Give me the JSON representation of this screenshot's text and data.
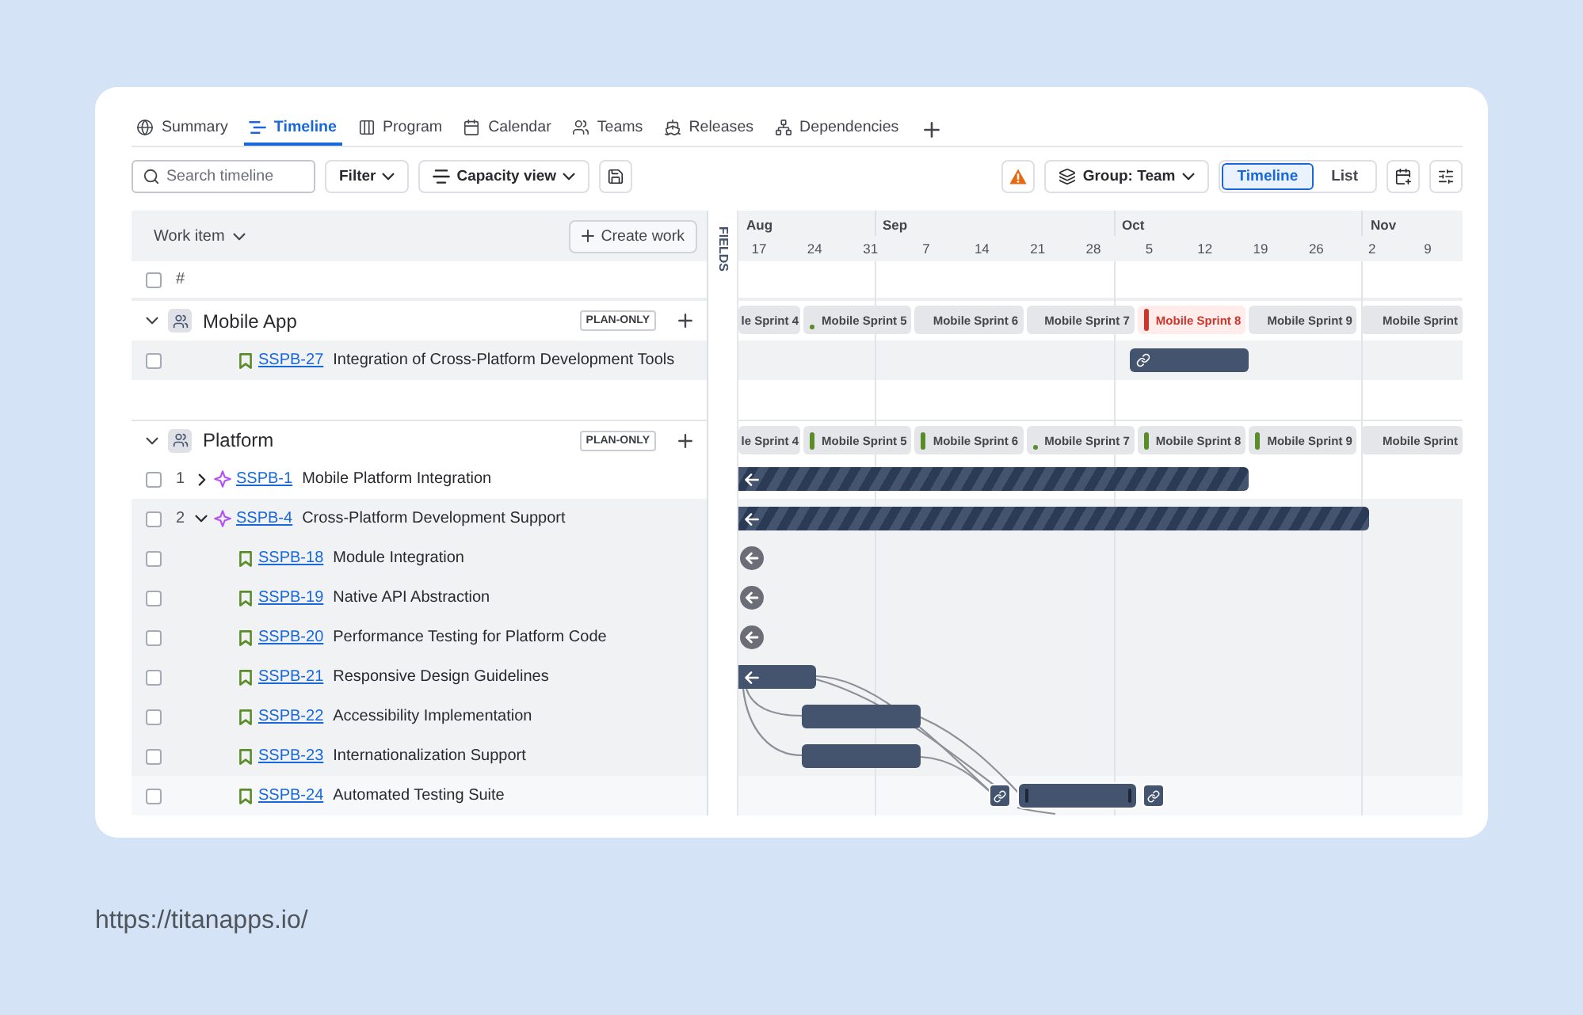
{
  "tabs": [
    {
      "label": "Summary",
      "selected": false
    },
    {
      "label": "Timeline",
      "selected": true
    },
    {
      "label": "Program",
      "selected": false
    },
    {
      "label": "Calendar",
      "selected": false
    },
    {
      "label": "Teams",
      "selected": false
    },
    {
      "label": "Releases",
      "selected": false
    },
    {
      "label": "Dependencies",
      "selected": false
    }
  ],
  "toolbar": {
    "search": {
      "placeholder": "Search timeline"
    },
    "filter": "Filter",
    "capacity_view": "Capacity view",
    "group_by": "Group: Team",
    "view_switch": [
      {
        "label": "Timeline",
        "selected": true
      },
      {
        "label": "List",
        "selected": false
      }
    ]
  },
  "work_list": {
    "column": "Work item",
    "create_button": "Create work",
    "select_all": {
      "label": "#",
      "checked": false
    }
  },
  "fields_panel": {
    "label": "FIELDS"
  },
  "timeline": {
    "months": [
      "Aug",
      "Sep",
      "Oct",
      "Nov"
    ],
    "days": [
      "17",
      "24",
      "31",
      "7",
      "14",
      "21",
      "28",
      "5",
      "12",
      "19",
      "26",
      "2",
      "9"
    ]
  },
  "groups": [
    {
      "name": "Mobile App",
      "badge": "PLAN-ONLY",
      "expanded": true,
      "sprints": [
        {
          "name": "le Sprint 4",
          "alert": false,
          "kind": "plain"
        },
        {
          "name": "Mobile Sprint 5",
          "alert": false,
          "kind": "dot",
          "color": "#5b8c2a"
        },
        {
          "name": "Mobile Sprint 6",
          "alert": false,
          "kind": "plain"
        },
        {
          "name": "Mobile Sprint 7",
          "alert": false,
          "kind": "plain"
        },
        {
          "name": "Mobile Sprint 8",
          "alert": true,
          "kind": "bar",
          "color": "#c9372c"
        },
        {
          "name": "Mobile Sprint 9",
          "alert": false,
          "kind": "plain"
        },
        {
          "name": "Mobile Sprint",
          "alert": false,
          "kind": "plain"
        }
      ],
      "items": [
        {
          "kind": "story",
          "key": "SSPB-27",
          "title": "Integration of Cross-Platform Development Tools",
          "checked": false,
          "highlighted": true,
          "hovered": false,
          "bar": {
            "kind": "solid_link"
          }
        }
      ]
    },
    {
      "name": "Platform",
      "badge": "PLAN-ONLY",
      "expanded": true,
      "sprints": [
        {
          "name": "le Sprint 4",
          "alert": false,
          "kind": "plain"
        },
        {
          "name": "Mobile Sprint 5",
          "alert": false,
          "kind": "bar",
          "color": "#5b8c2a"
        },
        {
          "name": "Mobile Sprint 6",
          "alert": false,
          "kind": "bar",
          "color": "#5b8c2a"
        },
        {
          "name": "Mobile Sprint 7",
          "alert": false,
          "kind": "dot",
          "color": "#5b8c2a"
        },
        {
          "name": "Mobile Sprint 8",
          "alert": false,
          "kind": "bar",
          "color": "#5b8c2a"
        },
        {
          "name": "Mobile Sprint 9",
          "alert": false,
          "kind": "bar",
          "color": "#5b8c2a"
        },
        {
          "name": "Mobile Sprint",
          "alert": false,
          "kind": "plain"
        }
      ],
      "items": [
        {
          "kind": "epic",
          "number": "1",
          "key": "SSPB-1",
          "title": "Mobile Platform Integration",
          "expanded": false,
          "checked": false,
          "highlighted": false,
          "hovered": false,
          "bar": {
            "kind": "striped_arrow"
          }
        },
        {
          "kind": "epic",
          "number": "2",
          "key": "SSPB-4",
          "title": "Cross-Platform Development Support",
          "expanded": true,
          "checked": false,
          "highlighted": true,
          "hovered": false,
          "bar": {
            "kind": "striped_arrow"
          },
          "children": [
            {
              "kind": "story",
              "key": "SSPB-18",
              "title": "Module Integration",
              "checked": false,
              "highlighted": true,
              "hovered": false,
              "bar": {
                "kind": "before_view"
              }
            },
            {
              "kind": "story",
              "key": "SSPB-19",
              "title": "Native API Abstraction",
              "checked": false,
              "highlighted": true,
              "hovered": false,
              "bar": {
                "kind": "before_view"
              }
            },
            {
              "kind": "story",
              "key": "SSPB-20",
              "title": "Performance Testing for Platform Code",
              "checked": false,
              "highlighted": true,
              "hovered": false,
              "bar": {
                "kind": "before_view"
              }
            },
            {
              "kind": "story",
              "key": "SSPB-21",
              "title": "Responsive Design Guidelines",
              "checked": false,
              "highlighted": true,
              "hovered": false,
              "bar": {
                "kind": "solid_arrow"
              }
            },
            {
              "kind": "story",
              "key": "SSPB-22",
              "title": "Accessibility Implementation",
              "checked": false,
              "highlighted": true,
              "hovered": false,
              "bar": {
                "kind": "solid"
              }
            },
            {
              "kind": "story",
              "key": "SSPB-23",
              "title": "Internationalization Support",
              "checked": false,
              "highlighted": true,
              "hovered": false,
              "bar": {
                "kind": "solid"
              }
            },
            {
              "kind": "story",
              "key": "SSPB-24",
              "title": "Automated Testing Suite",
              "checked": false,
              "highlighted": false,
              "hovered": true,
              "bar": {
                "kind": "solid"
              }
            }
          ]
        }
      ]
    }
  ],
  "footer": {
    "url": "https://titanapps.io/"
  }
}
